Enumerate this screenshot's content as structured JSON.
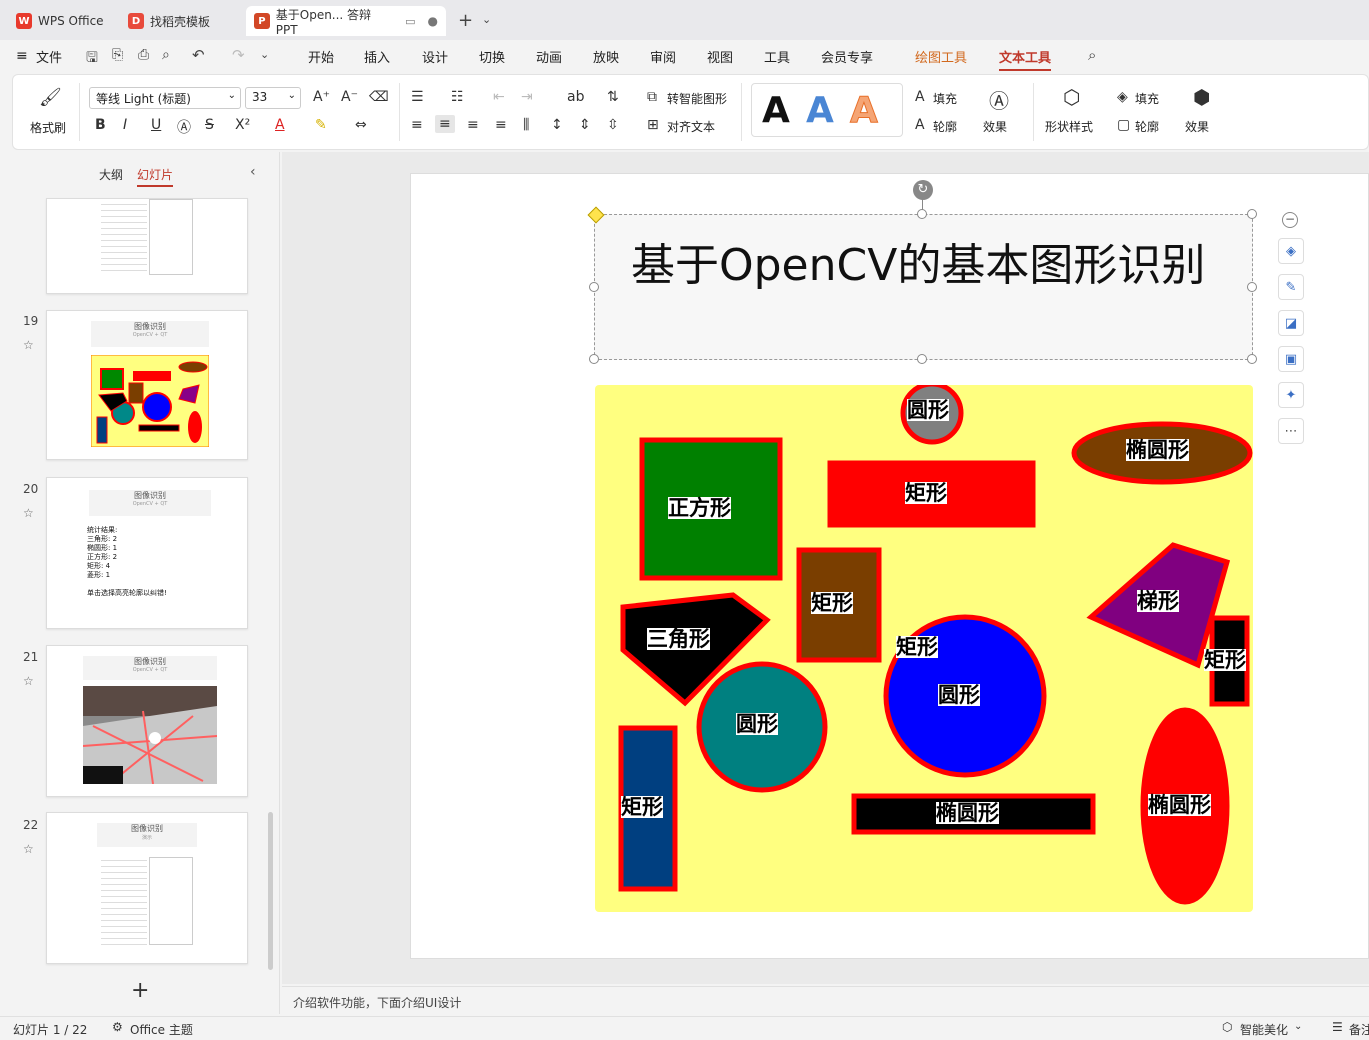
{
  "tabs": [
    {
      "label": "WPS Office"
    },
    {
      "label": "找稻壳模板"
    },
    {
      "label": "基于Open... 答辩PPT"
    }
  ],
  "menu": {
    "file": "文件",
    "items": [
      "开始",
      "插入",
      "设计",
      "切换",
      "动画",
      "放映",
      "审阅",
      "视图",
      "工具",
      "会员专享"
    ],
    "drawing_tools": "绘图工具",
    "text_tools": "文本工具"
  },
  "ribbon": {
    "format_painter": "格式刷",
    "font_name": "等线 Light (标题)",
    "font_size": "33",
    "smart_shape": "转智能图形",
    "align_text": "对齐文本",
    "fill": "填充",
    "outline": "轮廓",
    "effect": "效果",
    "shape_style": "形状样式",
    "wordart_glyph": "A",
    "format_buttons": [
      "B",
      "I",
      "U"
    ],
    "superscript": "X²",
    "font_color_glyph": "A"
  },
  "panel": {
    "outline_tab": "大纲",
    "slides_tab": "幻灯片",
    "slides": [
      {
        "num": "19",
        "title": "图像识别",
        "sub": "OpenCV + QT"
      },
      {
        "num": "20",
        "title": "图像识别",
        "sub": "OpenCV + QT",
        "lines": [
          "统计结果:",
          "三角形: 2",
          "椭圆形: 1",
          "正方形: 2",
          "矩形: 4",
          "菱形: 1",
          "",
          "单击选择高亮轮廓以纠错!"
        ]
      },
      {
        "num": "21",
        "title": "图像识别",
        "sub": "OpenCV + QT"
      },
      {
        "num": "22",
        "title": "图像识别",
        "sub": "演示"
      }
    ],
    "add": "+"
  },
  "slide": {
    "title": "基于OpenCV的基本图形识别",
    "labels": {
      "circle_top": "圆形",
      "ellipse_top": "椭圆形",
      "square": "正方形",
      "rect_red": "矩形",
      "rect_brown": "矩形",
      "trapezoid": "梯形",
      "triangle": "三角形",
      "rect_small": "矩形",
      "rect_center": "矩形",
      "circle_blue": "圆形",
      "circle_teal": "圆形",
      "rect_blue": "矩形",
      "ellipse_bar": "椭圆形",
      "ellipse_red": "椭圆形"
    }
  },
  "notes": "介绍软件功能，下面介绍UI设计",
  "status": {
    "slide_count": "幻灯片 1 / 22",
    "theme": "Office 主题",
    "beautify": "智能美化",
    "remarks": "备注"
  },
  "colors": {
    "accent": "#c0392b",
    "wps_red": "#e8392c",
    "ppt_orange": "#d24726",
    "slide_bg": "#ffff80"
  }
}
